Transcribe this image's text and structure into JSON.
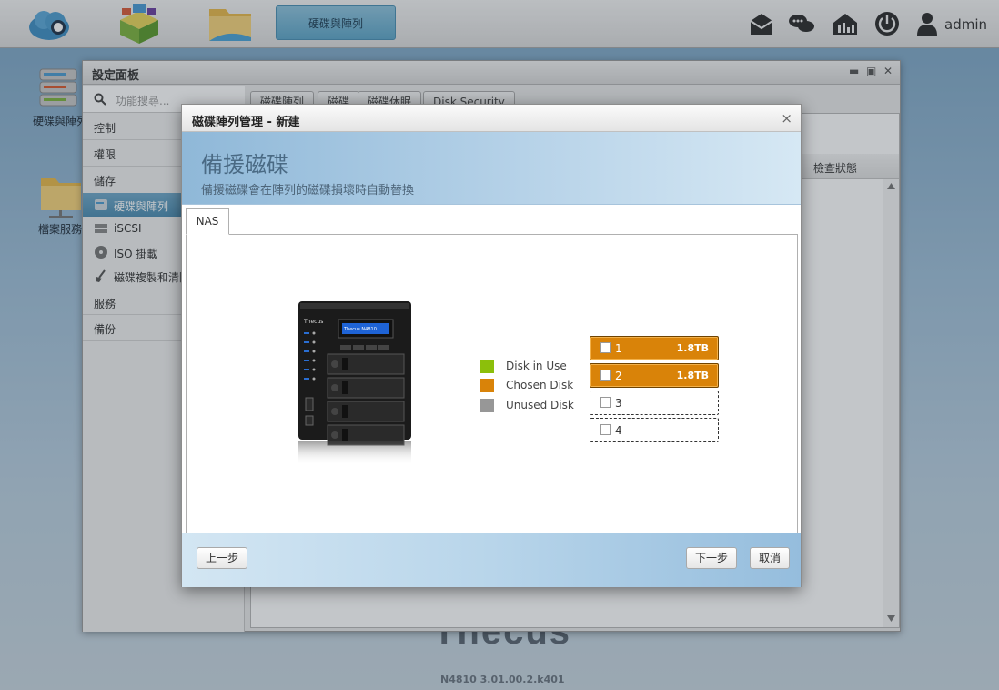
{
  "topbar": {
    "active_tab_label": "硬碟與陣列",
    "user_label": "admin"
  },
  "desktop": {
    "icon1_label": "硬碟與陣列",
    "icon2_label": "檔案服務"
  },
  "footer_brand": {
    "logo_text": "Thecus",
    "version": "N4810   3.01.00.2.k401"
  },
  "settings": {
    "title": "設定面板",
    "search_placeholder": "功能搜尋...",
    "sidebar": {
      "control": "控制",
      "permission": "權限",
      "storage": "儲存",
      "disk_raid": "硬碟與陣列",
      "iscsi": "iSCSI",
      "iso_mount": "ISO 掛載",
      "disk_clone": "磁碟複製和清除",
      "service": "服務",
      "backup": "備份"
    },
    "tabs": [
      "磁碟陣列",
      "磁碟",
      "磁碟休眠",
      "Disk Security"
    ],
    "column_header": "檢查狀態"
  },
  "modal": {
    "title": "磁碟陣列管理 - 新建",
    "heading": "備援磁碟",
    "subheading": "備援磁碟會在陣列的磁碟損壞時自動替換",
    "tab_label": "NAS",
    "device_lcd": "Thecus N4810",
    "legend": {
      "in_use": "Disk in Use",
      "chosen": "Chosen Disk",
      "unused": "Unused Disk"
    },
    "colors": {
      "in_use": "#8cbf0b",
      "chosen": "#d98309",
      "unused": "#979797"
    },
    "disks": [
      {
        "num": "1",
        "size": "1.8TB",
        "state": "chosen"
      },
      {
        "num": "2",
        "size": "1.8TB",
        "state": "chosen"
      },
      {
        "num": "3",
        "size": "",
        "state": "unused"
      },
      {
        "num": "4",
        "size": "",
        "state": "unused"
      }
    ],
    "buttons": {
      "prev": "上一步",
      "next": "下一步",
      "cancel": "取消"
    }
  }
}
